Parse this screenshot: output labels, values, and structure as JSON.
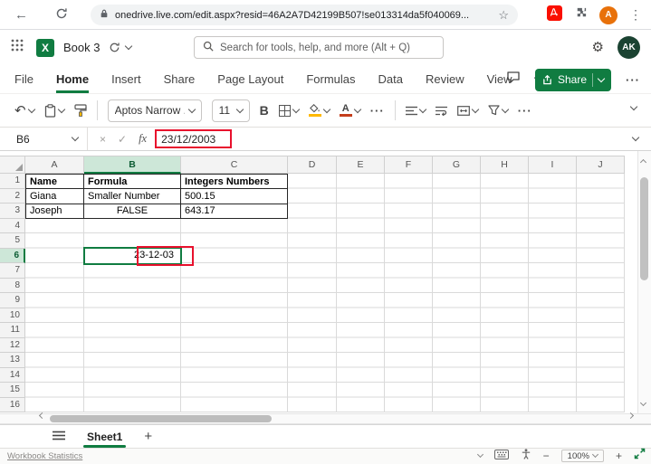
{
  "browser": {
    "url": "onedrive.live.com/edit.aspx?resid=46A2A7D42199B507!se013314da5f040069...",
    "profile_initial": "A"
  },
  "app_header": {
    "title": "Book 3",
    "search_placeholder": "Search for tools, help, and more (Alt + Q)",
    "user_initials": "AK"
  },
  "ribbon": {
    "tabs": [
      {
        "label": "File"
      },
      {
        "label": "Home",
        "active": true
      },
      {
        "label": "Insert"
      },
      {
        "label": "Share"
      },
      {
        "label": "Page Layout"
      },
      {
        "label": "Formulas"
      },
      {
        "label": "Data"
      },
      {
        "label": "Review"
      },
      {
        "label": "View"
      }
    ],
    "share_button": "Share"
  },
  "toolbar": {
    "font_name": "Aptos Narrow ...",
    "font_size": "11",
    "bold": "B",
    "font_color_letter": "A"
  },
  "formula_bar": {
    "name_box": "B6",
    "fx": "fx",
    "value": "23/12/2003"
  },
  "grid": {
    "columns": [
      "A",
      "B",
      "C",
      "D",
      "E",
      "F",
      "G",
      "H",
      "I",
      "J"
    ],
    "rows": [
      "1",
      "2",
      "3",
      "4",
      "5",
      "6",
      "7",
      "8",
      "9",
      "10",
      "11",
      "12",
      "13",
      "14",
      "15",
      "16"
    ],
    "selected_column": "B",
    "selected_row": "6",
    "table": {
      "header": {
        "a": "Name",
        "b": "Formula",
        "c": "Integers Numbers"
      },
      "row2": {
        "a": "Giana",
        "b": "Smaller Number",
        "c": "500.15"
      },
      "row3": {
        "a": "Joseph",
        "b": "FALSE",
        "c": "643.17"
      }
    },
    "active_cell": {
      "ref": "B6",
      "display": "23-12-03"
    }
  },
  "sheet_bar": {
    "active_sheet": "Sheet1"
  },
  "status_bar": {
    "left_link": "Workbook Statistics",
    "zoom": "100%"
  },
  "icons": {
    "back": "←",
    "star": "☆",
    "menu_dots": "⋮",
    "undo": "↶",
    "gear": "⚙",
    "excel_logo": "X",
    "cancel": "×",
    "enter": "✓",
    "ellipsis": "···",
    "plus": "+",
    "minus": "−",
    "sheet_plus": "+"
  },
  "colors": {
    "excel_green": "#107C41",
    "annotation_red": "#E8112D",
    "fill_yellow": "#FFB900",
    "font_color_red": "#C43E1C"
  }
}
